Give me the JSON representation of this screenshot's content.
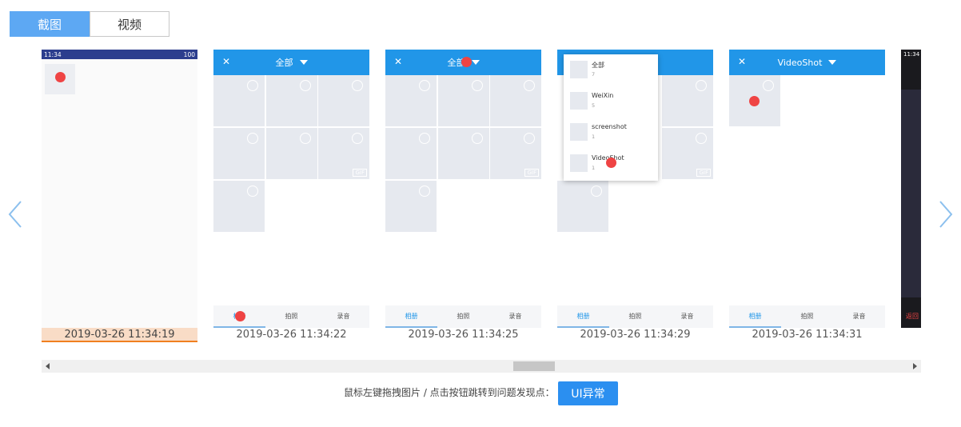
{
  "tabs": [
    {
      "label": "截图",
      "active": true
    },
    {
      "label": "视频",
      "active": false
    }
  ],
  "frames": [
    {
      "timestamp": "2019-03-26 11:34:19",
      "selected": true
    },
    {
      "timestamp": "2019-03-26 11:34:22",
      "selected": false
    },
    {
      "timestamp": "2019-03-26 11:34:25",
      "selected": false
    },
    {
      "timestamp": "2019-03-26 11:34:29",
      "selected": false
    },
    {
      "timestamp": "2019-03-26 11:34:31",
      "selected": false
    }
  ],
  "phone": {
    "status_time": "11:34",
    "status_battery": "100",
    "partial_time": "11:34",
    "partial_label": "返回"
  },
  "album": {
    "all_label": "全部",
    "videoshot_label": "VideoShot",
    "close_symbol": "✕",
    "gif_label": "GIF",
    "bottom_tabs": [
      "相册",
      "拍照",
      "录音"
    ]
  },
  "dropdown": [
    {
      "name": "全部",
      "count": "7"
    },
    {
      "name": "WeiXin",
      "count": "5"
    },
    {
      "name": "screenshot",
      "count": "1"
    },
    {
      "name": "VideoShot",
      "count": "1"
    }
  ],
  "footer": {
    "hint": "鼠标左键拖拽图片 / 点击按钮跳转到问题发现点：",
    "button_label": "UI异常"
  },
  "colors": {
    "accent": "#5da8f3",
    "app_bar": "#2196e8",
    "marker": "#ef4444",
    "selected_bg": "#f9dcc6",
    "selected_border": "#f08020",
    "button": "#2b8ff0"
  },
  "icons": [
    "chevron-left-icon",
    "chevron-right-icon",
    "close-icon",
    "caret-down-icon",
    "radio-circle-icon"
  ]
}
